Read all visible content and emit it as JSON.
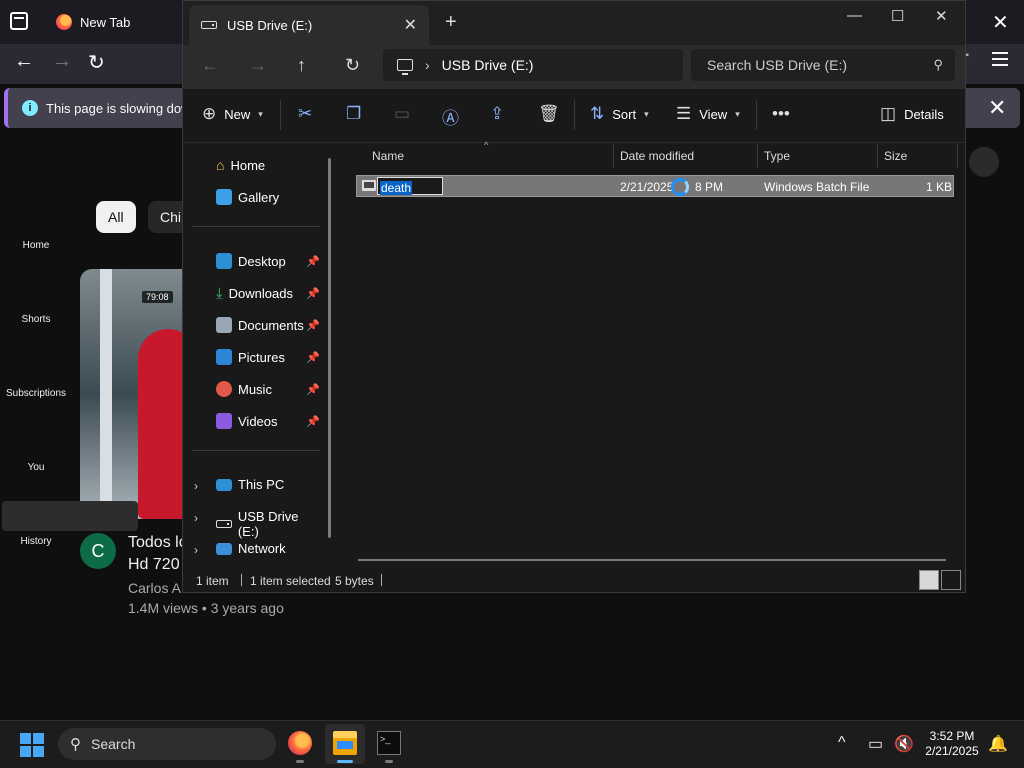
{
  "browser": {
    "tab_title": "New Tab",
    "notification_text": "This page is slowing down",
    "youtube": {
      "sidebar": [
        "Home",
        "Shorts",
        "Subscriptions",
        "You",
        "History"
      ],
      "chips": [
        "All",
        "Chi"
      ],
      "video": {
        "duration": "79:08",
        "avatar_letter": "C",
        "title_line1": "Todos lo",
        "title_line2": "Hd 720",
        "channel": "Carlos A",
        "meta": "1.4M views • 3 years ago"
      }
    }
  },
  "explorer": {
    "tab_title": "USB Drive (E:)",
    "address": {
      "path_label": "USB Drive (E:)"
    },
    "search_placeholder": "Search USB Drive (E:)",
    "commands": {
      "new": "New",
      "sort": "Sort",
      "view": "View",
      "details": "Details"
    },
    "nav": {
      "home": "Home",
      "gallery": "Gallery",
      "desktop": "Desktop",
      "downloads": "Downloads",
      "documents": "Documents",
      "pictures": "Pictures",
      "music": "Music",
      "videos": "Videos",
      "this_pc": "This PC",
      "usb_drive": "USB Drive (E:)",
      "network": "Network"
    },
    "columns": {
      "name": "Name",
      "date_modified": "Date modified",
      "type": "Type",
      "size": "Size"
    },
    "files": [
      {
        "name": "death",
        "date_visible_start": "2/21/2025",
        "date_visible_end": "8 PM",
        "type": "Windows Batch File",
        "size": "1 KB"
      }
    ],
    "status": {
      "count": "1 item",
      "selected": "1 item selected",
      "bytes": "5 bytes"
    }
  },
  "taskbar": {
    "search_label": "Search",
    "time": "3:52 PM",
    "date": "2/21/2025"
  }
}
